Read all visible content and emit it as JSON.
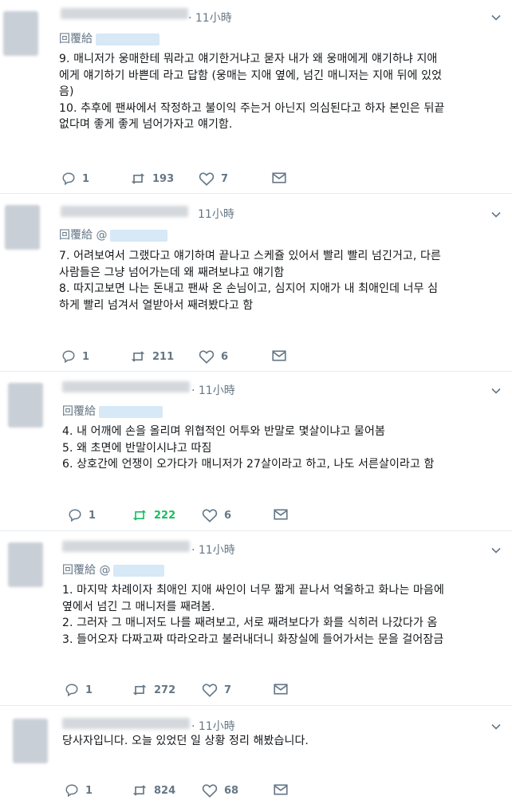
{
  "colors": {
    "text": "#14171a",
    "muted": "#657786",
    "retweeted": "#17bf63",
    "border": "#e6ecf0"
  },
  "icons": [
    "reply-icon",
    "retweet-icon",
    "like-icon",
    "message-icon",
    "chevron-down-icon"
  ],
  "tweets": [
    {
      "time": "· 11小時",
      "reply_prefix": "回覆給",
      "lines": [
        "9. 매니저가 웅매한테 뭐라고 얘기한거냐고 묻자 내가 왜 웅매에게 얘기하냐 지애",
        "에게 얘기하기 바쁜데 라고 답함 (웅매는 지애 옆에, 넘긴 매니저는 지애 뒤에 있었",
        "음)",
        "10. 추후에 팬싸에서 작정하고 불이익 주는거 아닌지 의심된다고 하자 본인은 뒤끝",
        "없다며 좋게 좋게 넘어가자고 얘기함."
      ],
      "replies": "1",
      "retweets": "193",
      "likes": "7",
      "retweeted": false
    },
    {
      "time": "11小時",
      "reply_prefix": "回覆給 @",
      "lines": [
        "7. 어려보여서 그랬다고 얘기하며 끝나고 스케쥴 있어서 빨리 빨리 넘긴거고, 다른",
        "사람들은 그냥 넘어가는데 왜 째려보냐고 얘기함",
        "8. 따지고보면 나는 돈내고 팬싸 온 손님이고, 심지어 지애가 내 최애인데 너무 심",
        "하게 빨리 넘겨서 열받아서 째려봤다고 함"
      ],
      "replies": "1",
      "retweets": "211",
      "likes": "6",
      "retweeted": false
    },
    {
      "time": "· 11小時",
      "reply_prefix": "回覆給",
      "lines": [
        "4. 내 어깨에 손을 올리며 위협적인 어투와 반말로 몇살이냐고 물어봄",
        "5. 왜 초면에 반말이시냐고 따짐",
        "6. 상호간에 언쟁이 오가다가 매니저가 27살이라고 하고, 나도 서른살이라고 함"
      ],
      "replies": "1",
      "retweets": "222",
      "likes": "6",
      "retweeted": true
    },
    {
      "time": "· 11小時",
      "reply_prefix": "回覆給 @",
      "lines": [
        "1. 마지막 차례이자 최애인 지애 싸인이 너무 짧게 끝나서 억울하고 화나는 마음에",
        "옆에서 넘긴 그 매니저를 째려봄.",
        "2. 그러자 그 매니저도 나를 째려보고, 서로 째려보다가 화를 식히러 나갔다가 옴",
        "3. 들어오자 다짜고짜 따라오라고 불러내더니 화장실에 들어가서는 문을 걸어잠금"
      ],
      "replies": "1",
      "retweets": "272",
      "likes": "7",
      "retweeted": false
    },
    {
      "time": "· 11小時",
      "reply_prefix": "",
      "lines": [
        "당사자입니다. 오늘 있었던 일 상황 정리 해봤습니다."
      ],
      "replies": "1",
      "retweets": "824",
      "likes": "68",
      "retweeted": false
    }
  ]
}
